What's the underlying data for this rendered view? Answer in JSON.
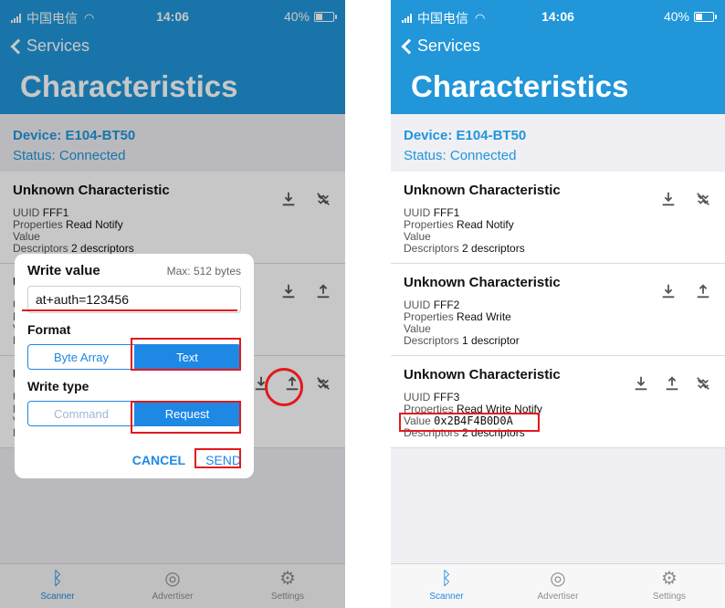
{
  "status_bar": {
    "carrier": "中国电信",
    "time": "14:06",
    "battery": "40%",
    "battery_level": 0.4
  },
  "nav": {
    "back_label": "Services",
    "title": "Characteristics"
  },
  "device": {
    "device_label": "Device:",
    "device_name": "E104-BT50",
    "status_label": "Status:",
    "status_value": "Connected"
  },
  "labels": {
    "uuid": "UUID",
    "properties": "Properties",
    "value": "Value",
    "descriptors": "Descriptors"
  },
  "characteristics": [
    {
      "title": "Unknown Characteristic",
      "uuid": "FFF1",
      "properties": "Read Notify",
      "value": "",
      "descriptors": "2 descriptors"
    },
    {
      "title": "Unknown Characteristic",
      "uuid": "FFF2",
      "properties": "Read Write",
      "value": "",
      "descriptors": "1 descriptor"
    },
    {
      "title": "Unknown Characteristic",
      "uuid": "FFF3",
      "properties": "Read Write Notify",
      "value": "0x2B4F4B0D0A",
      "descriptors": "2 descriptors"
    }
  ],
  "dialog": {
    "title": "Write value",
    "max": "Max: 512 bytes",
    "input_value": "at+auth=123456",
    "format_label": "Format",
    "format_options": [
      "Byte Array",
      "Text"
    ],
    "write_type_label": "Write type",
    "write_type_options": [
      "Command",
      "Request"
    ],
    "cancel": "CANCEL",
    "send": "SEND"
  },
  "tabs": [
    {
      "label": "Scanner",
      "icon": "bluetooth-icon"
    },
    {
      "label": "Advertiser",
      "icon": "broadcast-icon"
    },
    {
      "label": "Settings",
      "icon": "gear-icon"
    }
  ],
  "colors": {
    "header": "#2196d9",
    "accent": "#1e88e5",
    "annotation": "#e3191c"
  }
}
